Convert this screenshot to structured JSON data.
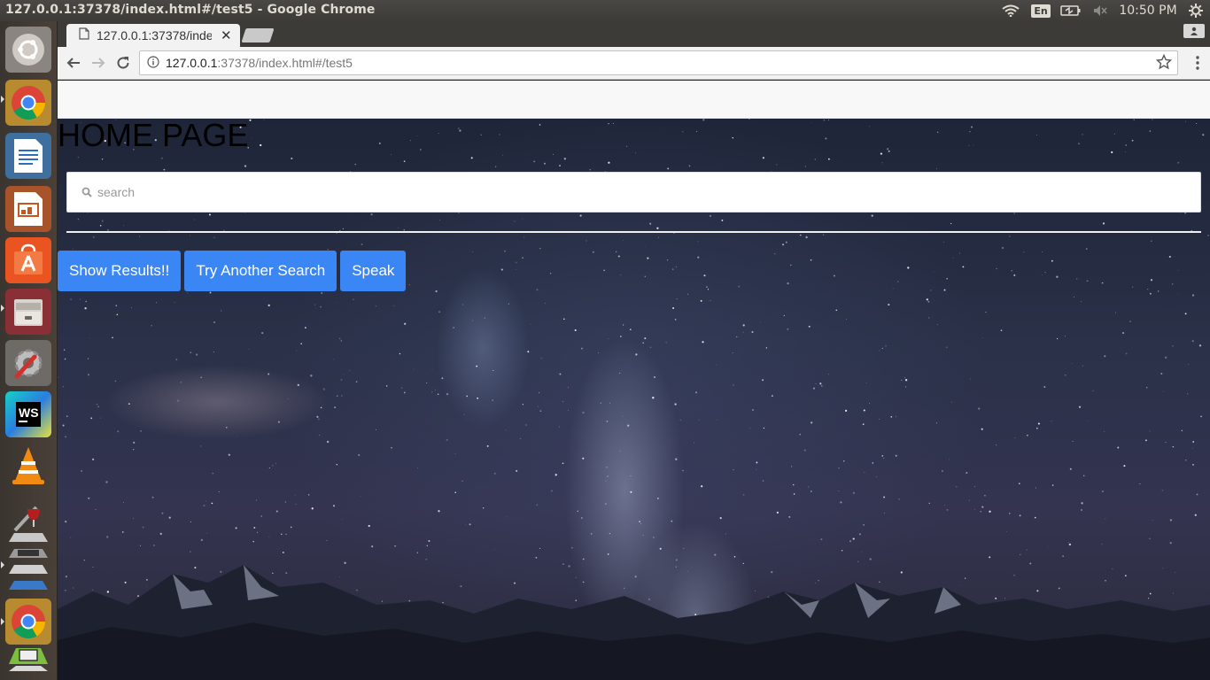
{
  "window": {
    "title": "127.0.0.1:37378/index.html#/test5 - Google Chrome"
  },
  "system_tray": {
    "language": "En",
    "clock": "10:50 PM"
  },
  "launcher": {
    "items": [
      {
        "name": "ubuntu-dash-icon",
        "color": "#d9d5cf"
      },
      {
        "name": "chrome-icon",
        "color": "#e0a12e"
      },
      {
        "name": "libreoffice-writer-icon",
        "color": "#2a6fb7"
      },
      {
        "name": "libreoffice-impress-icon",
        "color": "#c6571e"
      },
      {
        "name": "ubuntu-software-icon",
        "color": "#e95420"
      },
      {
        "name": "files-icon",
        "color": "#8a2a2a"
      },
      {
        "name": "system-settings-icon",
        "color": "#888888"
      },
      {
        "name": "webstorm-icon",
        "color": "#1ad1c8"
      },
      {
        "name": "vlc-icon",
        "color": "#f08a12"
      },
      {
        "name": "wine-tools-icon",
        "color": "#9a9a9a"
      },
      {
        "name": "stacked-apps-icon",
        "color": "#b0b0b0"
      },
      {
        "name": "chrome-icon-2",
        "color": "#e0a12e"
      },
      {
        "name": "remote-desktop-icon",
        "color": "#7cbf3f"
      }
    ]
  },
  "browser": {
    "tab_title": "127.0.0.1:37378/inde",
    "url_host": "127.0.0.1",
    "url_rest": ":37378/index.html#/test5"
  },
  "page": {
    "heading": "HOME PAGE",
    "search_placeholder": "search",
    "buttons": {
      "show_results": "Show Results!!",
      "try_another": "Try Another Search",
      "speak": "Speak"
    }
  },
  "colors": {
    "button_blue": "#3a86f5",
    "ubuntu_panel": "#3c3b37"
  }
}
